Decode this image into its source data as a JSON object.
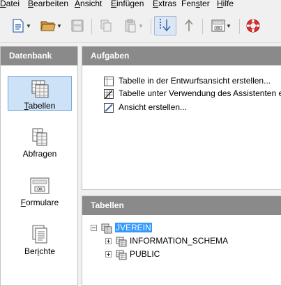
{
  "menubar": {
    "items": [
      {
        "label": "Datei"
      },
      {
        "label": "Bearbeiten"
      },
      {
        "label": "Ansicht"
      },
      {
        "label": "Einfügen"
      },
      {
        "label": "Extras"
      },
      {
        "label": "Fenster"
      },
      {
        "label": "Hilfe"
      }
    ]
  },
  "toolbar": {
    "icons": [
      "new-document-icon",
      "open-folder-icon",
      "save-icon",
      "copy-icon",
      "paste-icon",
      "sort-descending-icon",
      "sort-ascending-icon",
      "form-icon",
      "help-lifebuoy-icon"
    ]
  },
  "database_panel": {
    "title": "Datenbank",
    "items": [
      {
        "label": "Tabellen",
        "selected": true
      },
      {
        "label": "Abfragen"
      },
      {
        "label": "Formulare"
      },
      {
        "label": "Berichte"
      }
    ]
  },
  "tasks_panel": {
    "title": "Aufgaben",
    "tasks": [
      {
        "label": "Tabelle in der Entwurfsansicht erstellen..."
      },
      {
        "label": "Tabelle unter Verwendung des Assistenten er"
      },
      {
        "label": "Ansicht erstellen..."
      }
    ]
  },
  "tables_panel": {
    "title": "Tabellen",
    "tree": {
      "root": "JVEREIN",
      "children": [
        {
          "label": "INFORMATION_SCHEMA"
        },
        {
          "label": "PUBLIC"
        }
      ]
    }
  },
  "colors": {
    "panel_header": "#8a8a8a",
    "selection": "#3399ff",
    "selected_item_bg": "#cde2f7"
  }
}
